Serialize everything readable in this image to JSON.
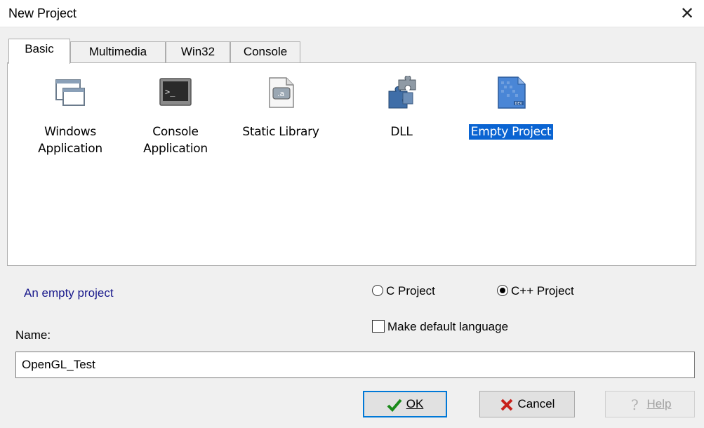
{
  "window": {
    "title": "New Project",
    "close_glyph": "✕"
  },
  "tabs": [
    {
      "label": "Basic",
      "active": true
    },
    {
      "label": "Multimedia",
      "active": false
    },
    {
      "label": "Win32",
      "active": false
    },
    {
      "label": "Console",
      "active": false
    }
  ],
  "templates": [
    {
      "label": "Windows\nApplication",
      "icon": "windows-app-icon"
    },
    {
      "label": "Console\nApplication",
      "icon": "console-app-icon"
    },
    {
      "label": "Static Library",
      "icon": "static-library-icon"
    },
    {
      "label": "DLL",
      "icon": "dll-puzzle-icon"
    },
    {
      "label": "Empty Project",
      "icon": "empty-project-icon",
      "selected": true
    }
  ],
  "description": "An empty project",
  "language": {
    "c_label": "C Project",
    "cpp_label": "C++ Project",
    "selected": "cpp",
    "default_label": "Make default language",
    "default_checked": false
  },
  "name": {
    "label": "Name:",
    "value": "OpenGL_Test"
  },
  "buttons": {
    "ok": "OK",
    "cancel": "Cancel",
    "help": "Help",
    "help_enabled": false
  },
  "colors": {
    "selection": "#0a64d2",
    "ok_check": "#1a8a1a",
    "cancel_x": "#c8201a",
    "description_text": "#1a1a8c"
  }
}
